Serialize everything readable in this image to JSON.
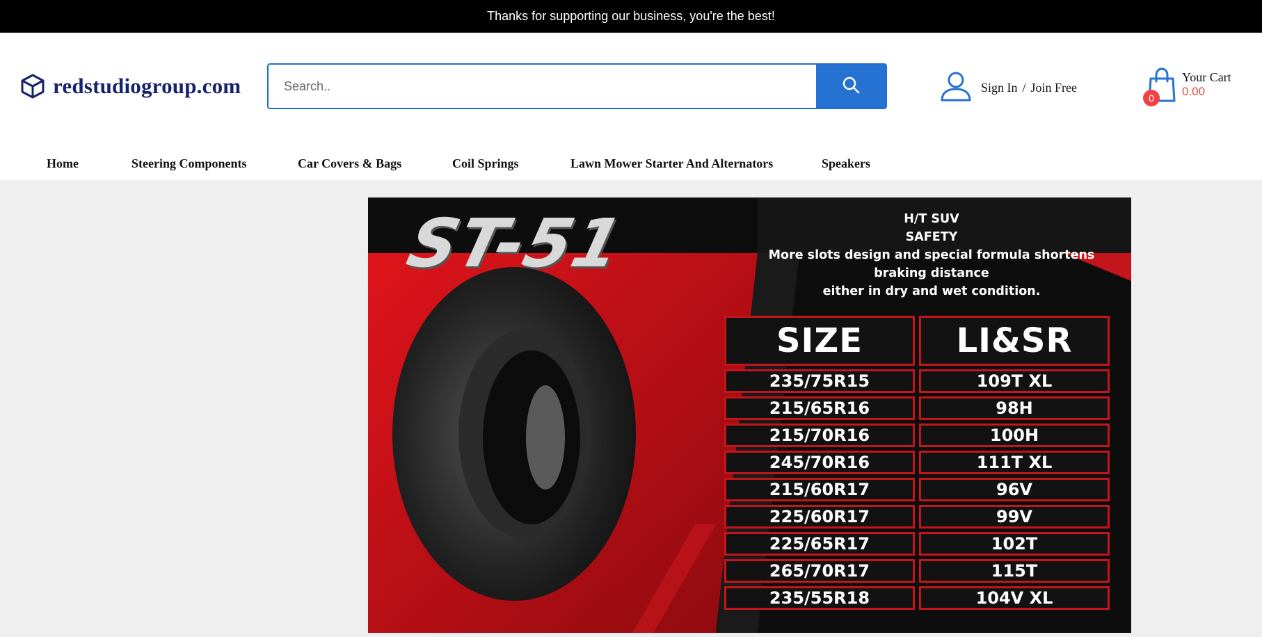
{
  "topbar": {
    "message": "Thanks for supporting our business, you're the best!"
  },
  "header": {
    "logo_text": "redstudiogroup.com",
    "search": {
      "placeholder": "Search.."
    },
    "account": {
      "sign_in": "Sign In",
      "separator": "/",
      "join": "Join Free"
    },
    "cart": {
      "count": "0",
      "label": "Your Cart",
      "total": "0.00"
    }
  },
  "nav": {
    "items": [
      {
        "label": "Home"
      },
      {
        "label": "Steering Components"
      },
      {
        "label": "Car Covers & Bags"
      },
      {
        "label": "Coil Springs"
      },
      {
        "label": "Lawn Mower Starter And Alternators"
      },
      {
        "label": "Speakers"
      }
    ]
  },
  "banner": {
    "model": "ST-51",
    "lines": [
      "H/T SUV",
      "SAFETY",
      "More slots design and special formula shortens",
      "braking distance",
      "either in dry and wet condition."
    ],
    "table": {
      "headers": [
        "SIZE",
        "LI&SR"
      ],
      "rows": [
        [
          "235/75R15",
          "109T XL"
        ],
        [
          "215/65R16",
          "98H"
        ],
        [
          "215/70R16",
          "100H"
        ],
        [
          "245/70R16",
          "111T XL"
        ],
        [
          "215/60R17",
          "96V"
        ],
        [
          "225/60R17",
          "99V"
        ],
        [
          "225/65R17",
          "102T"
        ],
        [
          "265/70R17",
          "115T"
        ],
        [
          "235/55R18",
          "104V XL"
        ]
      ]
    }
  },
  "colors": {
    "brand": "#16226a",
    "accent": "#2672d3",
    "cart_red": "#e84a4a",
    "banner_red": "#c4151c"
  }
}
